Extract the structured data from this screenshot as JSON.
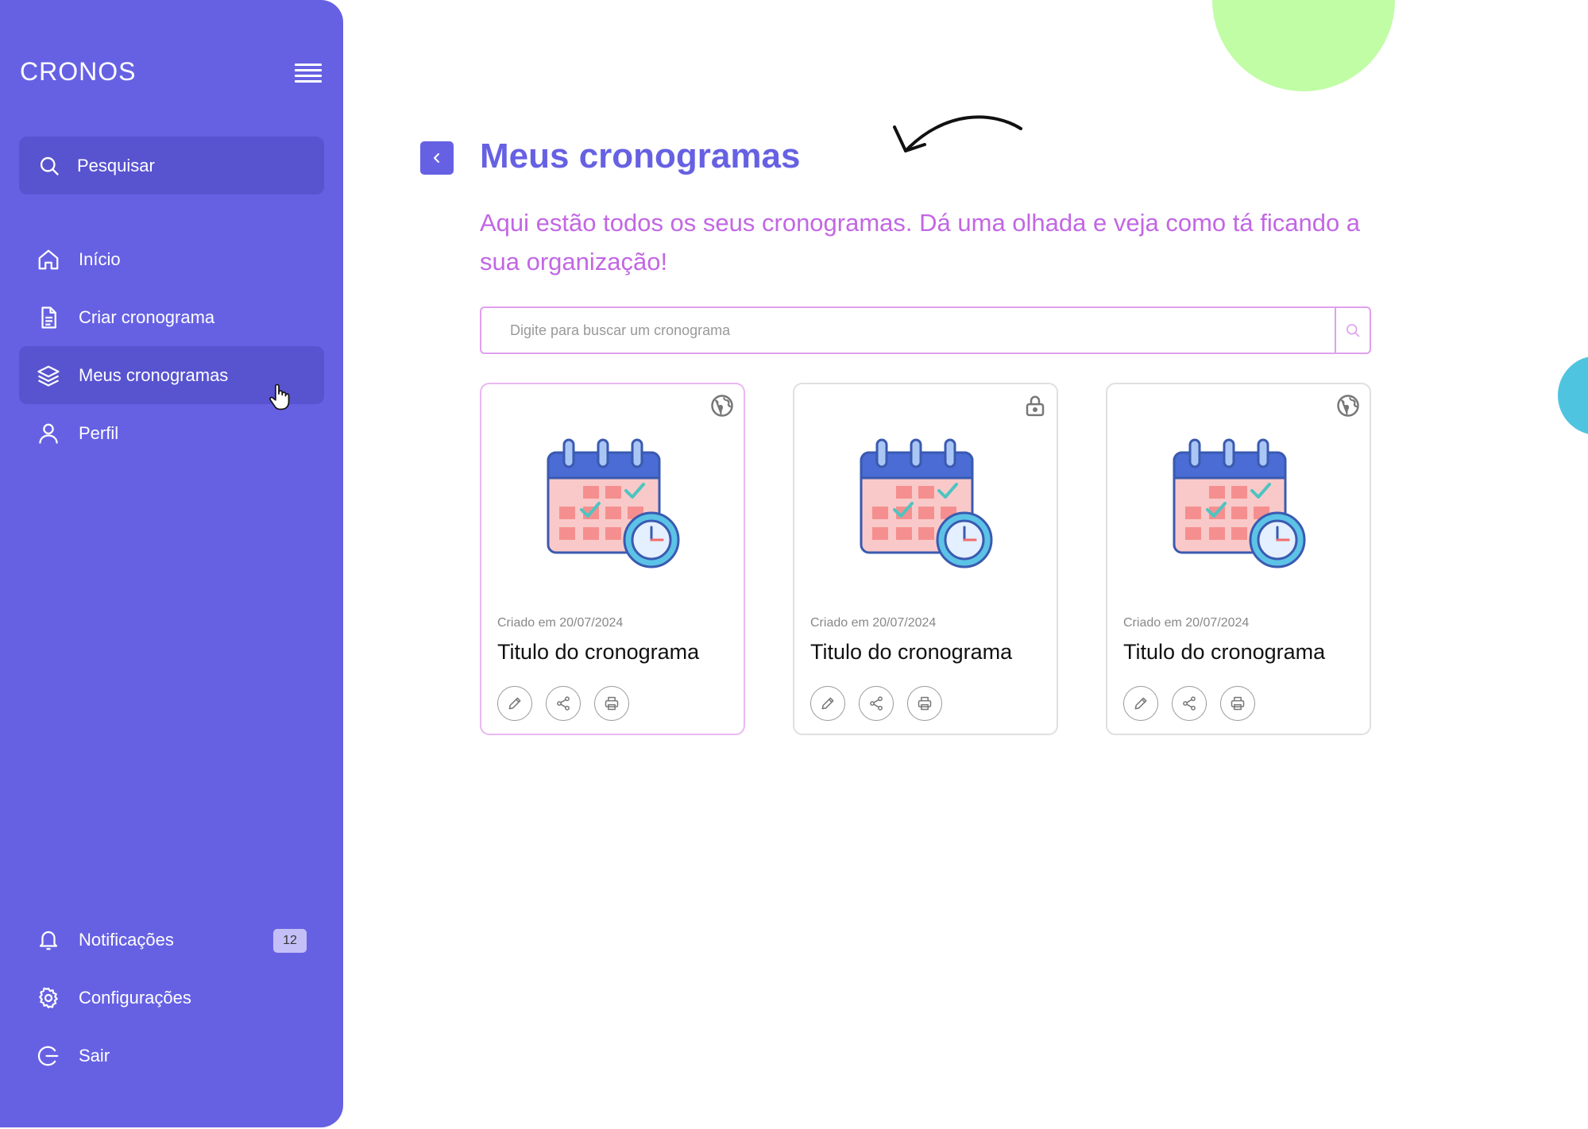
{
  "app": {
    "logo": "CRONOS"
  },
  "sidebar": {
    "search_label": "Pesquisar",
    "items": [
      {
        "label": "Início",
        "icon": "home-icon"
      },
      {
        "label": "Criar cronograma",
        "icon": "file-icon"
      },
      {
        "label": "Meus cronogramas",
        "icon": "layers-icon",
        "active": true
      },
      {
        "label": "Perfil",
        "icon": "user-icon"
      }
    ],
    "bottom_items": [
      {
        "label": "Notificações",
        "icon": "bell-icon",
        "badge": "12"
      },
      {
        "label": "Configurações",
        "icon": "gear-icon"
      },
      {
        "label": "Sair",
        "icon": "logout-icon"
      }
    ]
  },
  "main": {
    "title": "Meus cronogramas",
    "subtitle": "Aqui estão todos os seus cronogramas. Dá uma olhada e veja como tá ficando a sua organização!",
    "search_placeholder": "Digite para buscar um cronograma",
    "cards": [
      {
        "date": "Criado em 20/07/2024",
        "title": "Titulo do cronograma",
        "visibility": "globe-icon"
      },
      {
        "date": "Criado em 20/07/2024",
        "title": "Titulo do cronograma",
        "visibility": "lock-icon"
      },
      {
        "date": "Criado em 20/07/2024",
        "title": "Titulo do cronograma",
        "visibility": "globe-icon"
      }
    ]
  },
  "colors": {
    "sidebar": "#6661e3",
    "sidebar_active": "#5853cf",
    "title": "#6661e3",
    "subtitle": "#c267e3",
    "accent_green": "#c0fda5",
    "accent_blue": "#4ec4e0"
  }
}
